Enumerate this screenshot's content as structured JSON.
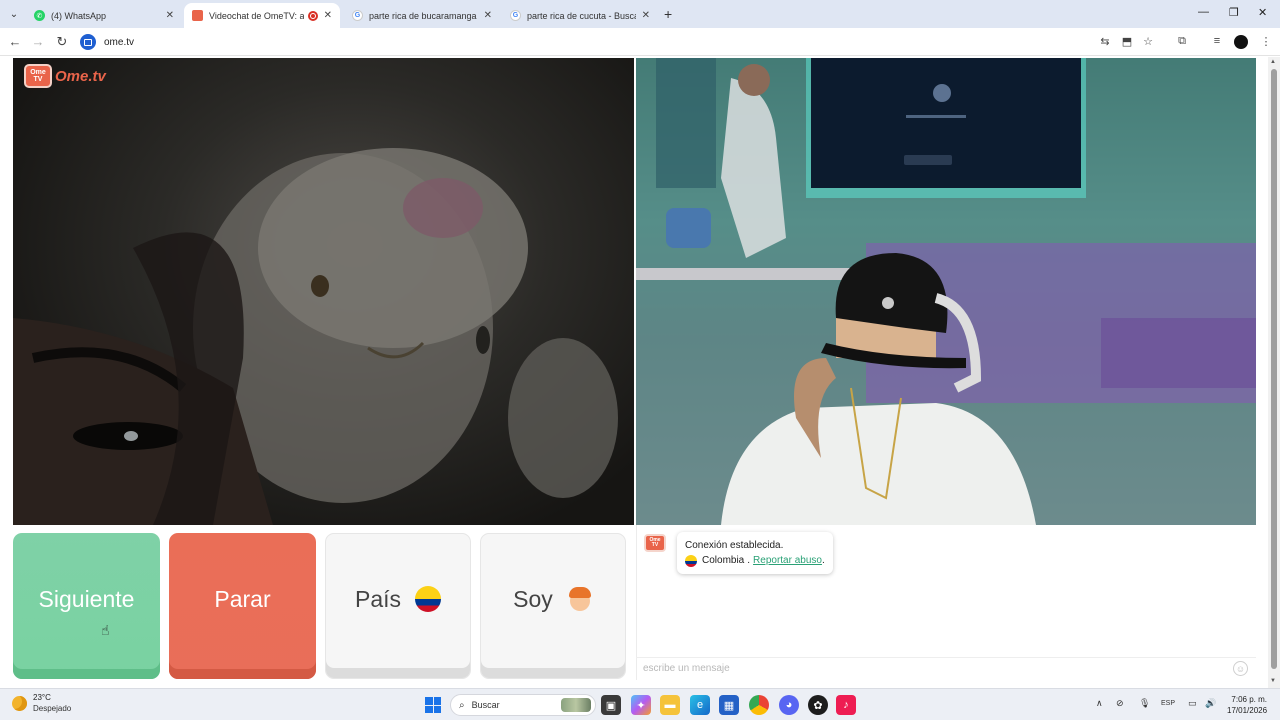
{
  "browser": {
    "tabs": [
      {
        "title": "(4) WhatsApp",
        "icon": "whatsapp-icon",
        "color": "#25d366",
        "active": false
      },
      {
        "title": "Videochat de OmeTV: altern",
        "icon": "ometv-icon",
        "color": "#e9644a",
        "active": true
      },
      {
        "title": "parte rica de bucaramanga - Bu",
        "icon": "google-icon",
        "color": "#4285f4",
        "active": false
      },
      {
        "title": "parte rica de cucuta - Buscar co",
        "icon": "google-icon",
        "color": "#4285f4",
        "active": false
      }
    ],
    "new_tab": "+",
    "url": "ome.tv"
  },
  "page": {
    "logo_text": "Ome.tv",
    "logo_badge_top": "Ome",
    "logo_badge_bottom": "TV",
    "buttons": {
      "next": "Siguiente",
      "stop": "Parar",
      "country": "País",
      "gender": "Soy"
    },
    "accent_green": "#79d2a1",
    "accent_red": "#e96e59"
  },
  "chat": {
    "status": "Conexión establecida.",
    "country": "Colombia",
    "separator": ".",
    "report_link": "Reportar abuso",
    "report_suffix": ".",
    "input_placeholder": "escribe un mensaje"
  },
  "taskbar": {
    "weather_temp": "23°C",
    "weather_desc": "Despejado",
    "search_placeholder": "Buscar",
    "language": "ESP",
    "time": "7:06 p. m.",
    "date": "17/01/2026"
  }
}
